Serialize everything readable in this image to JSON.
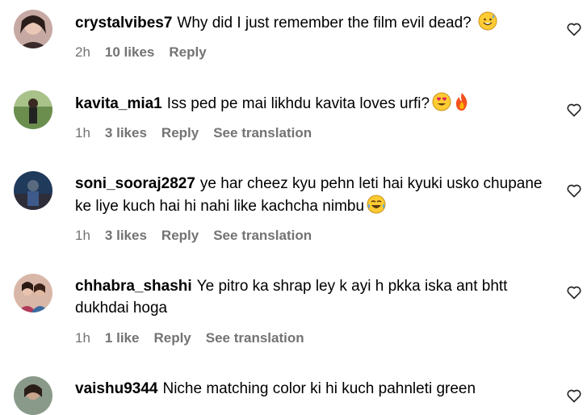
{
  "comments": [
    {
      "username": "crystalvibes7",
      "text": "Why did I just remember the film evil dead?",
      "emoji": "sweat-smile",
      "time": "2h",
      "likes": "10 likes",
      "reply": "Reply",
      "translation": ""
    },
    {
      "username": "kavita_mia1",
      "text": "Iss ped pe mai likhdu kavita loves urfi?",
      "emoji": "heart-eyes fire",
      "time": "1h",
      "likes": "3 likes",
      "reply": "Reply",
      "translation": "See translation"
    },
    {
      "username": "soni_sooraj2827",
      "text": "ye har cheez kyu pehn leti hai kyuki usko chupane ke liye kuch hai hi nahi like kachcha nimbu",
      "emoji": "joy",
      "time": "1h",
      "likes": "3 likes",
      "reply": "Reply",
      "translation": "See translation"
    },
    {
      "username": "chhabra_shashi",
      "text": "Ye pitro ka shrap ley k ayi h pkka iska ant bhtt dukhdai hoga",
      "emoji": "",
      "time": "1h",
      "likes": "1 like",
      "reply": "Reply",
      "translation": "See translation"
    },
    {
      "username": "vaishu9344",
      "text": "Niche matching color ki hi kuch pahnleti green",
      "emoji": "",
      "time": "",
      "likes": "",
      "reply": "",
      "translation": ""
    }
  ],
  "icons": {
    "like": "heart-outline-icon"
  },
  "colors": {
    "meta": "#737373",
    "text": "#000000"
  }
}
